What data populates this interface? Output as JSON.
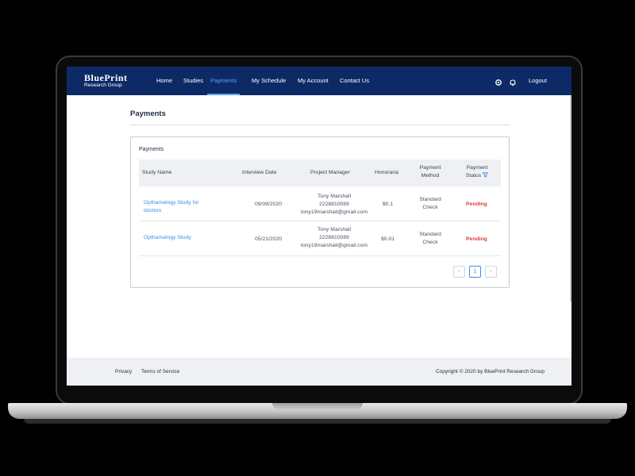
{
  "brand": {
    "name": "BluePrint",
    "subtitle": "Research Group"
  },
  "nav": {
    "items": [
      "Home",
      "Studies",
      "Payments",
      "My Schedule",
      "My Account",
      "Contact Us"
    ],
    "active": "Payments",
    "logout": "Logout",
    "icons": [
      "settings-gear-icon",
      "bell-icon"
    ]
  },
  "page": {
    "title": "Payments"
  },
  "card": {
    "title": "Payments",
    "columns": {
      "study": "Study Name",
      "date": "Interview Date",
      "manager": "Project Manager",
      "honoraria": "Honoraria",
      "method_1": "Payment",
      "method_2": "Method",
      "status_1": "Payment",
      "status_2": "Status"
    },
    "rows": [
      {
        "study_1": "Opthamalogy Study for",
        "study_2": "doctors",
        "date": "09/08/2020",
        "manager_name": "Tony Marshall",
        "manager_phone": "2228810089",
        "manager_email": "tony19marshall@gmail.com",
        "honoraria": "$0.1",
        "method_1": "Standard",
        "method_2": "Check",
        "status": "Pending"
      },
      {
        "study_1": "Opthamalogy Study",
        "date": "05/21/2020",
        "manager_name": "Tony Marshall",
        "manager_phone": "2228810089",
        "manager_email": "tony19marshall@gmail.com",
        "honoraria": "$0.01",
        "method_1": "Standard",
        "method_2": "Check",
        "status": "Pending"
      }
    ],
    "pagination": {
      "prev": "‹",
      "current": "1",
      "next": "›"
    }
  },
  "footer": {
    "links": [
      "Privacy",
      "Terms of Service"
    ],
    "copyright": "Copyright © 2020 by BluePrint Research Group"
  },
  "colors": {
    "nav_bg": "#0d2a66",
    "active": "#5aa2ff",
    "link": "#3d8bf0",
    "pending": "#e03a3a"
  }
}
